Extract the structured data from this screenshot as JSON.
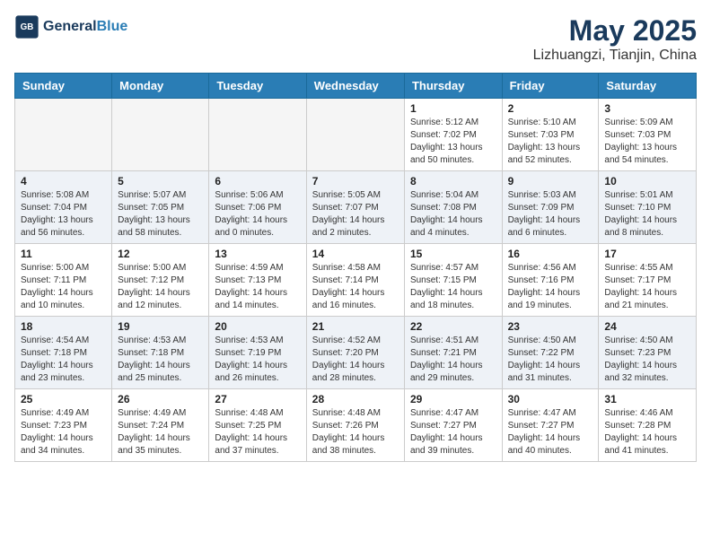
{
  "header": {
    "logo_line1": "General",
    "logo_line2": "Blue",
    "title": "May 2025",
    "subtitle": "Lizhuangzi, Tianjin, China"
  },
  "weekdays": [
    "Sunday",
    "Monday",
    "Tuesday",
    "Wednesday",
    "Thursday",
    "Friday",
    "Saturday"
  ],
  "weeks": [
    [
      {
        "day": "",
        "info": ""
      },
      {
        "day": "",
        "info": ""
      },
      {
        "day": "",
        "info": ""
      },
      {
        "day": "",
        "info": ""
      },
      {
        "day": "1",
        "info": "Sunrise: 5:12 AM\nSunset: 7:02 PM\nDaylight: 13 hours\nand 50 minutes."
      },
      {
        "day": "2",
        "info": "Sunrise: 5:10 AM\nSunset: 7:03 PM\nDaylight: 13 hours\nand 52 minutes."
      },
      {
        "day": "3",
        "info": "Sunrise: 5:09 AM\nSunset: 7:03 PM\nDaylight: 13 hours\nand 54 minutes."
      }
    ],
    [
      {
        "day": "4",
        "info": "Sunrise: 5:08 AM\nSunset: 7:04 PM\nDaylight: 13 hours\nand 56 minutes."
      },
      {
        "day": "5",
        "info": "Sunrise: 5:07 AM\nSunset: 7:05 PM\nDaylight: 13 hours\nand 58 minutes."
      },
      {
        "day": "6",
        "info": "Sunrise: 5:06 AM\nSunset: 7:06 PM\nDaylight: 14 hours\nand 0 minutes."
      },
      {
        "day": "7",
        "info": "Sunrise: 5:05 AM\nSunset: 7:07 PM\nDaylight: 14 hours\nand 2 minutes."
      },
      {
        "day": "8",
        "info": "Sunrise: 5:04 AM\nSunset: 7:08 PM\nDaylight: 14 hours\nand 4 minutes."
      },
      {
        "day": "9",
        "info": "Sunrise: 5:03 AM\nSunset: 7:09 PM\nDaylight: 14 hours\nand 6 minutes."
      },
      {
        "day": "10",
        "info": "Sunrise: 5:01 AM\nSunset: 7:10 PM\nDaylight: 14 hours\nand 8 minutes."
      }
    ],
    [
      {
        "day": "11",
        "info": "Sunrise: 5:00 AM\nSunset: 7:11 PM\nDaylight: 14 hours\nand 10 minutes."
      },
      {
        "day": "12",
        "info": "Sunrise: 5:00 AM\nSunset: 7:12 PM\nDaylight: 14 hours\nand 12 minutes."
      },
      {
        "day": "13",
        "info": "Sunrise: 4:59 AM\nSunset: 7:13 PM\nDaylight: 14 hours\nand 14 minutes."
      },
      {
        "day": "14",
        "info": "Sunrise: 4:58 AM\nSunset: 7:14 PM\nDaylight: 14 hours\nand 16 minutes."
      },
      {
        "day": "15",
        "info": "Sunrise: 4:57 AM\nSunset: 7:15 PM\nDaylight: 14 hours\nand 18 minutes."
      },
      {
        "day": "16",
        "info": "Sunrise: 4:56 AM\nSunset: 7:16 PM\nDaylight: 14 hours\nand 19 minutes."
      },
      {
        "day": "17",
        "info": "Sunrise: 4:55 AM\nSunset: 7:17 PM\nDaylight: 14 hours\nand 21 minutes."
      }
    ],
    [
      {
        "day": "18",
        "info": "Sunrise: 4:54 AM\nSunset: 7:18 PM\nDaylight: 14 hours\nand 23 minutes."
      },
      {
        "day": "19",
        "info": "Sunrise: 4:53 AM\nSunset: 7:18 PM\nDaylight: 14 hours\nand 25 minutes."
      },
      {
        "day": "20",
        "info": "Sunrise: 4:53 AM\nSunset: 7:19 PM\nDaylight: 14 hours\nand 26 minutes."
      },
      {
        "day": "21",
        "info": "Sunrise: 4:52 AM\nSunset: 7:20 PM\nDaylight: 14 hours\nand 28 minutes."
      },
      {
        "day": "22",
        "info": "Sunrise: 4:51 AM\nSunset: 7:21 PM\nDaylight: 14 hours\nand 29 minutes."
      },
      {
        "day": "23",
        "info": "Sunrise: 4:50 AM\nSunset: 7:22 PM\nDaylight: 14 hours\nand 31 minutes."
      },
      {
        "day": "24",
        "info": "Sunrise: 4:50 AM\nSunset: 7:23 PM\nDaylight: 14 hours\nand 32 minutes."
      }
    ],
    [
      {
        "day": "25",
        "info": "Sunrise: 4:49 AM\nSunset: 7:23 PM\nDaylight: 14 hours\nand 34 minutes."
      },
      {
        "day": "26",
        "info": "Sunrise: 4:49 AM\nSunset: 7:24 PM\nDaylight: 14 hours\nand 35 minutes."
      },
      {
        "day": "27",
        "info": "Sunrise: 4:48 AM\nSunset: 7:25 PM\nDaylight: 14 hours\nand 37 minutes."
      },
      {
        "day": "28",
        "info": "Sunrise: 4:48 AM\nSunset: 7:26 PM\nDaylight: 14 hours\nand 38 minutes."
      },
      {
        "day": "29",
        "info": "Sunrise: 4:47 AM\nSunset: 7:27 PM\nDaylight: 14 hours\nand 39 minutes."
      },
      {
        "day": "30",
        "info": "Sunrise: 4:47 AM\nSunset: 7:27 PM\nDaylight: 14 hours\nand 40 minutes."
      },
      {
        "day": "31",
        "info": "Sunrise: 4:46 AM\nSunset: 7:28 PM\nDaylight: 14 hours\nand 41 minutes."
      }
    ]
  ]
}
